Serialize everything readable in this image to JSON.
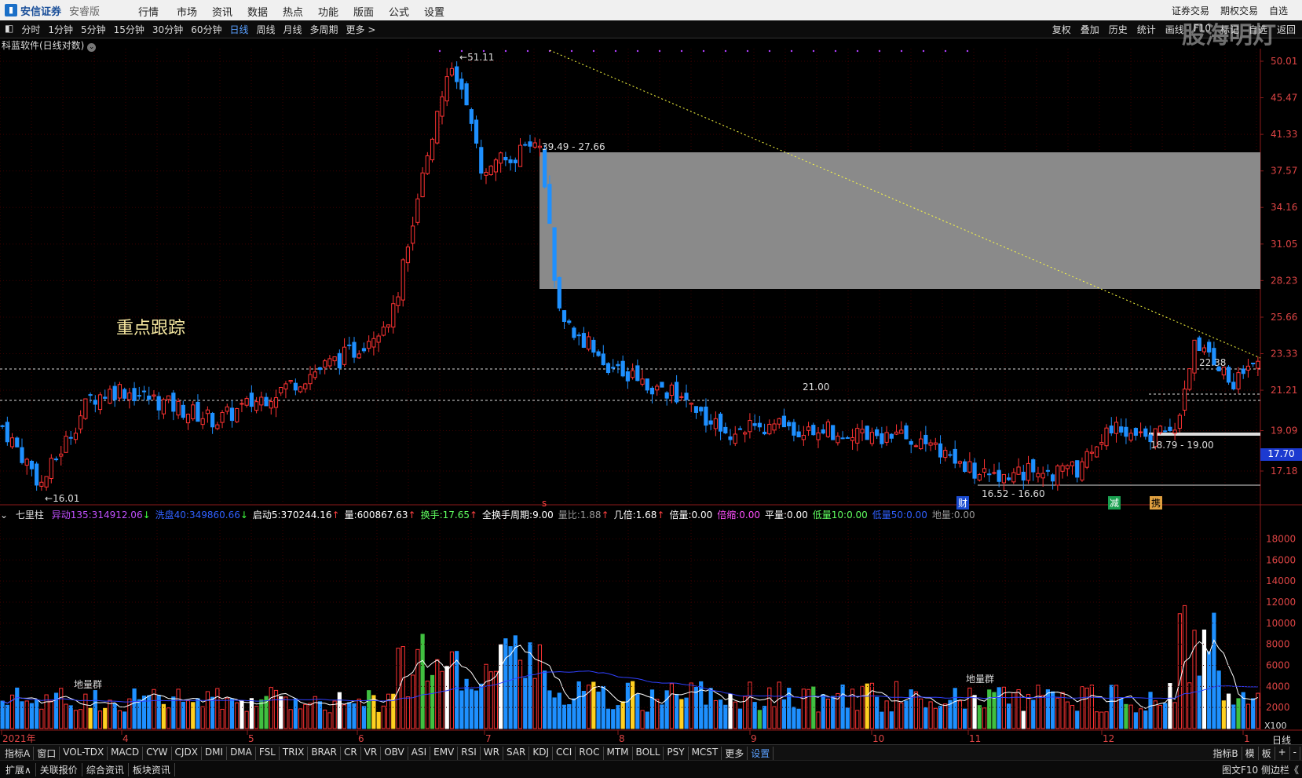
{
  "menu": {
    "brand": "安信证券",
    "edition": "安睿版",
    "items": [
      "行情",
      "市场",
      "资讯",
      "数据",
      "热点",
      "功能",
      "版面",
      "公式",
      "设置"
    ],
    "right_items": [
      "证券交易",
      "期权交易",
      "自选"
    ]
  },
  "toolbar": {
    "periods": [
      "分时",
      "1分钟",
      "5分钟",
      "15分钟",
      "30分钟",
      "60分钟",
      "日线",
      "周线",
      "月线",
      "多周期",
      "更多 >"
    ],
    "active_period": "日线",
    "tools": [
      "复权",
      "叠加",
      "历史",
      "统计",
      "画线",
      "F10",
      "标记",
      "自选",
      "返回"
    ]
  },
  "stock_title": "科蓝软件(日线对数)",
  "main_chart": {
    "price_ticks": [
      "50.01",
      "45.47",
      "41.33",
      "37.57",
      "34.16",
      "31.05",
      "28.23",
      "25.66",
      "23.33",
      "21.21",
      "19.09",
      "17.18"
    ],
    "last_price_tag": "17.70",
    "annotations": {
      "high": "51.11",
      "low": "16.01",
      "gap_box": "39.49 - 27.66",
      "level_2100": "21.00",
      "level_2238": "22.38",
      "range_1879": "18.79 - 19.00",
      "range_1652": "16.52 - 16.60"
    },
    "focus_text": "重点跟踪",
    "event_marks": [
      "财",
      "减",
      "携"
    ],
    "x_marker": "s"
  },
  "volume_chart": {
    "indicator_name": "七里柱",
    "stats": [
      {
        "label": "异动135:",
        "value": "314912.06",
        "color": "#c050ff",
        "arrow": "↓"
      },
      {
        "label": "洗盘40:",
        "value": "349860.66",
        "color": "#3060ff",
        "arrow": "↓"
      },
      {
        "label": "启动5:",
        "value": "370244.16",
        "color": "#ffffff",
        "arrow": "↑"
      },
      {
        "label": "量:",
        "value": "600867.63",
        "color": "#ffffff",
        "arrow": "↑"
      },
      {
        "label": "换手:",
        "value": "17.65",
        "color": "#60ff60",
        "arrow": "↑"
      },
      {
        "label": "全换手周期:",
        "value": "9.00",
        "color": "#ffffff",
        "arrow": ""
      },
      {
        "label": "量比:",
        "value": "1.88",
        "color": "#999999",
        "arrow": "↑"
      },
      {
        "label": "几倍:",
        "value": "1.68",
        "color": "#ffffff",
        "arrow": "↑"
      },
      {
        "label": "倍量:",
        "value": "0.00",
        "color": "#ffffff",
        "arrow": ""
      },
      {
        "label": "倍缩:",
        "value": "0.00",
        "color": "#ff50ff",
        "arrow": ""
      },
      {
        "label": "平量:",
        "value": "0.00",
        "color": "#ffffff",
        "arrow": ""
      },
      {
        "label": "低量10:",
        "value": "0.00",
        "color": "#60ff60",
        "arrow": ""
      },
      {
        "label": "低量50:",
        "value": "0.00",
        "color": "#3060ff",
        "arrow": ""
      },
      {
        "label": "地量:",
        "value": "0.00",
        "color": "#999999",
        "arrow": ""
      }
    ],
    "vol_ticks": [
      "18000",
      "16000",
      "14000",
      "12000",
      "10000",
      "8000",
      "6000",
      "4000",
      "2000"
    ],
    "unit": "X100",
    "label_left": "地量群",
    "label_right": "地量群"
  },
  "x_axis": {
    "labels": [
      "2021年",
      "4",
      "5",
      "6",
      "7",
      "8",
      "9",
      "10",
      "11",
      "12",
      "1"
    ],
    "period_button": "日线"
  },
  "indicator_tabs": [
    "指标A",
    "窗口",
    "VOL-TDX",
    "MACD",
    "CYW",
    "CJDX",
    "DMI",
    "DMA",
    "FSL",
    "TRIX",
    "BRAR",
    "CR",
    "VR",
    "OBV",
    "ASI",
    "EMV",
    "RSI",
    "WR",
    "SAR",
    "KDJ",
    "CCI",
    "ROC",
    "MTM",
    "BOLL",
    "PSY",
    "MCST",
    "更多",
    "设置"
  ],
  "indicator_right": [
    "指标B",
    "模",
    "板",
    "+",
    "-"
  ],
  "bottom_tabs": [
    "扩展∧",
    "关联报价",
    "综合资讯",
    "板块资讯"
  ],
  "bottom_right": "图文F10 侧边栏《",
  "watermark": "股海明灯",
  "chart_data": {
    "type": "candlestick",
    "title": "科蓝软件(日线对数)",
    "ylim": [
      16.01,
      51.11
    ],
    "annotations": [
      "51.11",
      "16.01",
      "39.49 - 27.66",
      "21.00",
      "22.38",
      "18.79 - 19.00",
      "16.52 - 16.60"
    ],
    "waypoints": [
      {
        "i": 0,
        "c": 19.3
      },
      {
        "i": 8,
        "c": 16.6
      },
      {
        "i": 18,
        "c": 20.8
      },
      {
        "i": 24,
        "c": 21.3
      },
      {
        "i": 44,
        "c": 19.6
      },
      {
        "i": 60,
        "c": 21.7
      },
      {
        "i": 72,
        "c": 23.5
      },
      {
        "i": 80,
        "c": 26.0
      },
      {
        "i": 88,
        "c": 41.5
      },
      {
        "i": 92,
        "c": 50.0
      },
      {
        "i": 98,
        "c": 38.0
      },
      {
        "i": 110,
        "c": 40.0
      },
      {
        "i": 114,
        "c": 25.7
      },
      {
        "i": 126,
        "c": 22.2
      },
      {
        "i": 138,
        "c": 21.0
      },
      {
        "i": 148,
        "c": 19.1
      },
      {
        "i": 160,
        "c": 19.3
      },
      {
        "i": 176,
        "c": 19.0
      },
      {
        "i": 190,
        "c": 18.5
      },
      {
        "i": 200,
        "c": 16.9
      },
      {
        "i": 206,
        "c": 17.1
      },
      {
        "i": 220,
        "c": 17.2
      },
      {
        "i": 228,
        "c": 19.3
      },
      {
        "i": 234,
        "c": 18.8
      },
      {
        "i": 240,
        "c": 19.0
      },
      {
        "i": 244,
        "c": 24.2
      },
      {
        "i": 252,
        "c": 21.7
      },
      {
        "i": 256,
        "c": 22.4
      }
    ],
    "volume_series": "VOL",
    "volume_ylim": [
      0,
      18000
    ]
  }
}
